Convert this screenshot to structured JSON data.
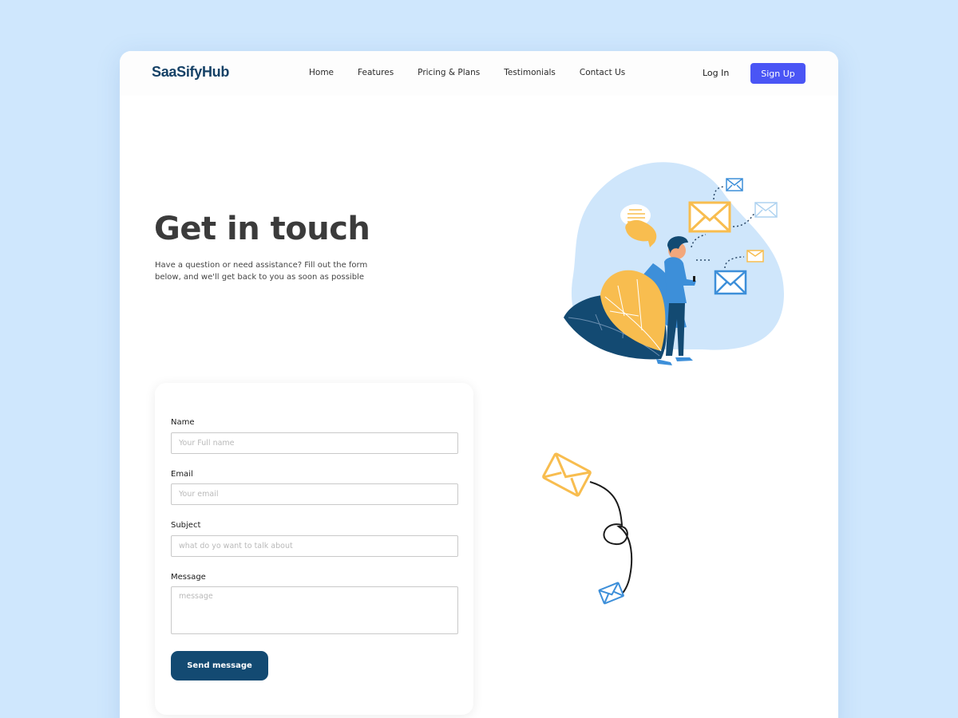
{
  "brand": {
    "name": "SaaSifyHub"
  },
  "nav": {
    "links": [
      "Home",
      "Features",
      "Pricing & Plans",
      "Testimonials",
      "Contact Us"
    ],
    "login": "Log In",
    "signup": "Sign Up"
  },
  "hero": {
    "title": "Get in touch",
    "subtitle": "Have a question or need assistance? Fill out the form below, and we'll get back to you as soon as possible"
  },
  "form": {
    "name": {
      "label": "Name",
      "placeholder": "Your Full name",
      "value": ""
    },
    "email": {
      "label": "Email",
      "placeholder": "Your email",
      "value": ""
    },
    "subject": {
      "label": "Subject",
      "placeholder": "what do yo want to talk about",
      "value": ""
    },
    "message": {
      "label": "Message",
      "placeholder": "message",
      "value": ""
    },
    "submit_label": "Send message"
  },
  "colors": {
    "page_bg": "#cfe7fd",
    "brand": "#154166",
    "signup_button": "#4a55f5",
    "submit_button": "#134a72",
    "illustration_blob": "#cfe6fb",
    "envelope_yellow": "#f8bd4f",
    "envelope_blue": "#3d8fd9"
  },
  "icons": {
    "hero_illustration": "person-with-phone-emails-illustration",
    "bottom_illustration": "flying-envelopes-illustration"
  }
}
